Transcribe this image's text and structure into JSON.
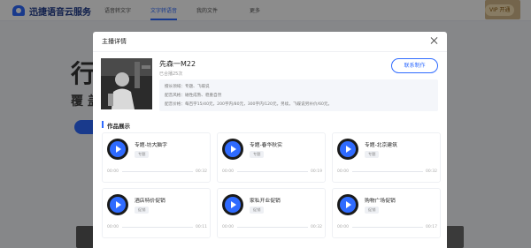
{
  "app": {
    "logo_text": "迅捷语音云服务",
    "nav": [
      "语音转文字",
      "文字转语音",
      "我的文件",
      "更多"
    ],
    "active_nav_index": 1,
    "vip_badge": "VIP 开通",
    "hero_line1": "行",
    "hero_line2": "覆 盖"
  },
  "modal": {
    "title": "主播详情",
    "host": {
      "name": "先森一M22",
      "sub": "已合播25次",
      "contact_label": "联系制作",
      "info": [
        "擅长领域：专题、飞碟说",
        "配音风格：磁性成熟、稳重自然",
        "配音价格：每百字15/40元，200字内/80元，300字内/120元，另续，飞碟说另补价/60元。"
      ]
    },
    "section_title": "作品展示",
    "works": [
      {
        "title": "专题-坊大脑字",
        "tag": "专题",
        "start": "00:00",
        "end": "00:32",
        "progress": 0.0
      },
      {
        "title": "专题-春华秋实",
        "tag": "专题",
        "start": "00:00",
        "end": "00:19",
        "progress": 0.0
      },
      {
        "title": "专题-北京建筑",
        "tag": "专题",
        "start": "00:00",
        "end": "00:32",
        "progress": 0.0
      },
      {
        "title": "酒店特价促销",
        "tag": "促销",
        "start": "00:00",
        "end": "00:11",
        "progress": 0.0
      },
      {
        "title": "家私开业促销",
        "tag": "促销",
        "start": "00:00",
        "end": "00:32",
        "progress": 0.0
      },
      {
        "title": "购物广场促销",
        "tag": "促销",
        "start": "00:00",
        "end": "00:17",
        "progress": 0.0
      }
    ]
  },
  "colors": {
    "accent": "#2f6bff",
    "overlay": "rgba(0,0,0,0.45)",
    "disc": "#1b1b1b"
  }
}
